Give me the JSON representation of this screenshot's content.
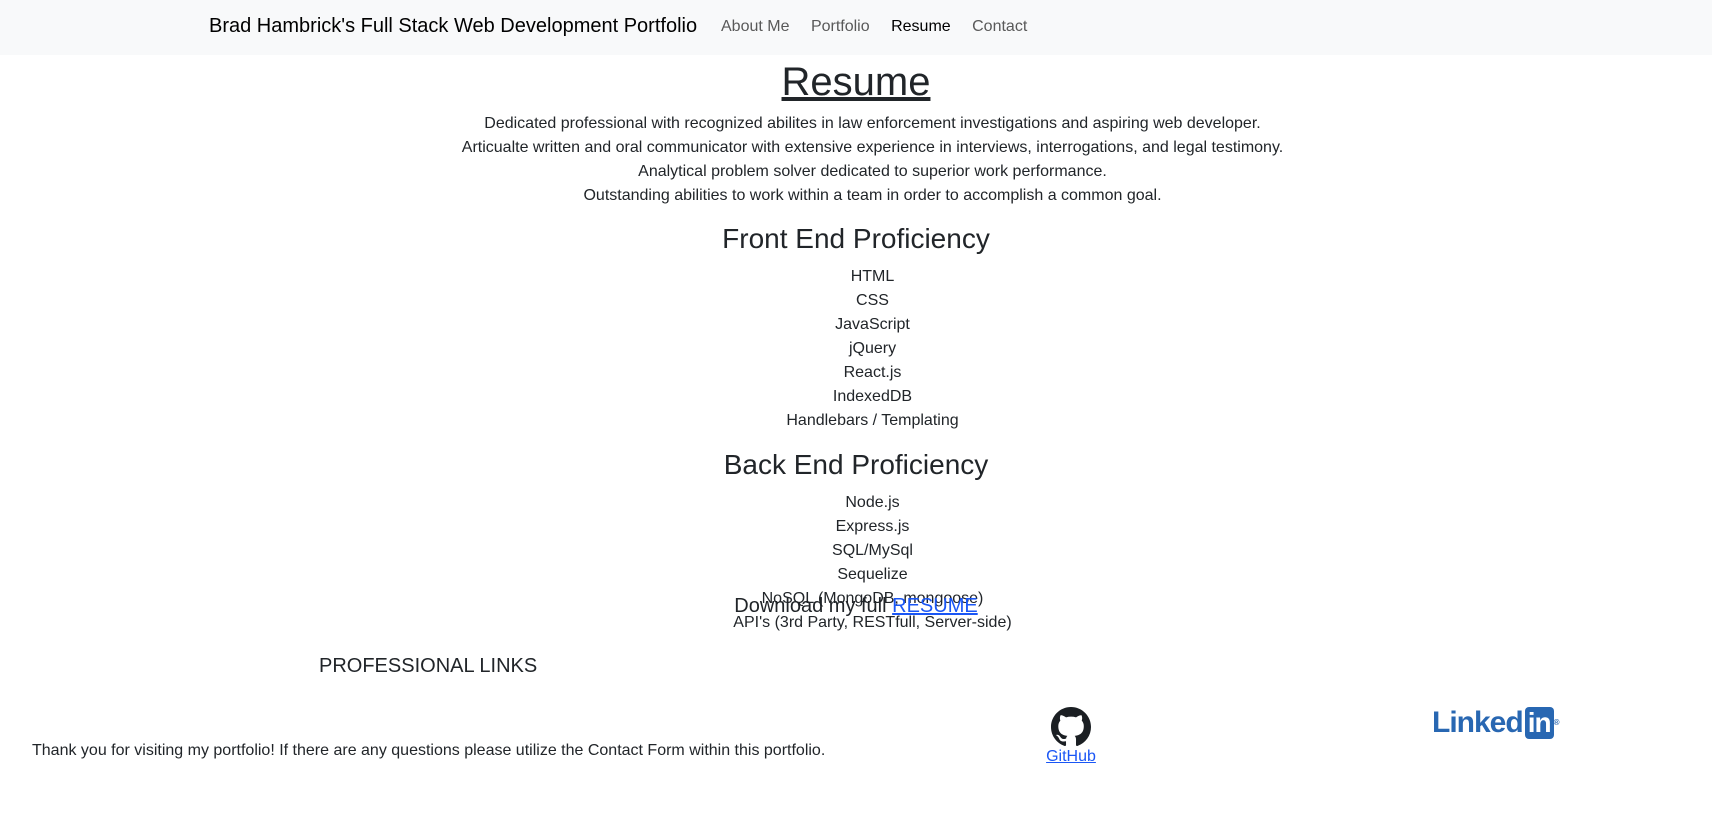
{
  "navbar": {
    "brand": "Brad Hambrick's Full Stack Web Development Portfolio",
    "links": [
      {
        "label": "About Me",
        "active": false
      },
      {
        "label": "Portfolio",
        "active": false
      },
      {
        "label": "Resume",
        "active": true
      },
      {
        "label": "Contact",
        "active": false
      }
    ]
  },
  "resume": {
    "title": "Resume",
    "summary": [
      "Dedicated professional with recognized abilites in law enforcement investigations and aspiring web developer.",
      "Articualte written and oral communicator with extensive experience in interviews, interrogations, and legal testimony.",
      "Analytical problem solver dedicated to superior work performance.",
      "Outstanding abilities to work within a team in order to accomplish a common goal."
    ],
    "front_end": {
      "heading": "Front End Proficiency",
      "items": [
        "HTML",
        "CSS",
        "JavaScript",
        "jQuery",
        "React.js",
        "IndexedDB",
        "Handlebars / Templating"
      ]
    },
    "back_end": {
      "heading": "Back End Proficiency",
      "items": [
        "Node.js",
        "Express.js",
        "SQL/MySql",
        "Sequelize",
        "NoSQL (MongoDB, mongoose)",
        "API's (3rd Party, RESTfull, Server-side)"
      ]
    },
    "download_text": "Download my full ",
    "download_link": "RESUME"
  },
  "footer": {
    "title": "PROFESSIONAL LINKS",
    "text": "Thank you for visiting my portfolio! If there are any questions please utilize the Contact Form within this portfolio.",
    "github_label": "GitHub",
    "github_icon": "github-icon",
    "linkedin_logo_text": "Linked",
    "linkedin_logo_box": "in",
    "linkedin_reg": "®"
  },
  "colors": {
    "navbar_bg": "#f8f9fa",
    "link": "#1a56f5",
    "linkedin": "#2867b2",
    "text": "#212529"
  }
}
